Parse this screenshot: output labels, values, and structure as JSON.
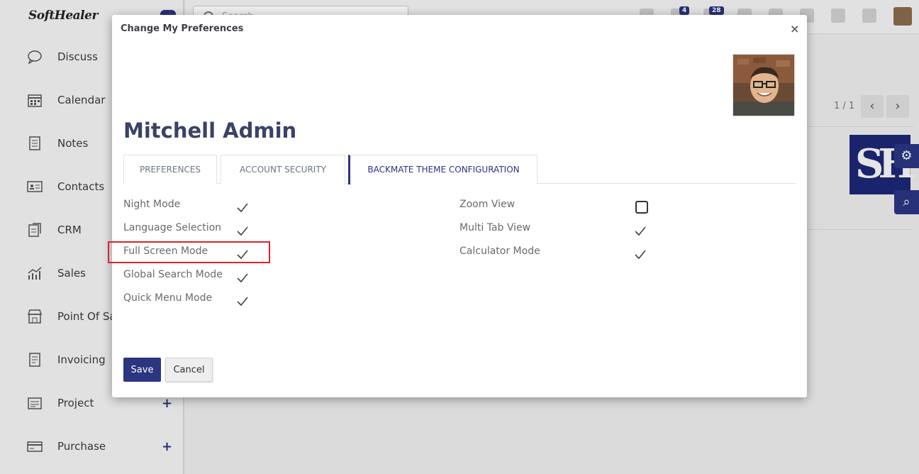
{
  "app": {
    "brand": "SoftHealer",
    "search_placeholder": "Search...",
    "badges": [
      "4",
      "28"
    ]
  },
  "sidebar": {
    "items": [
      {
        "label": "Discuss",
        "icon": "chat-icon",
        "plus": false
      },
      {
        "label": "Calendar",
        "icon": "calendar-icon",
        "plus": false
      },
      {
        "label": "Notes",
        "icon": "notes-icon",
        "plus": false
      },
      {
        "label": "Contacts",
        "icon": "contacts-icon",
        "plus": false
      },
      {
        "label": "CRM",
        "icon": "crm-icon",
        "plus": false
      },
      {
        "label": "Sales",
        "icon": "sales-chart-icon",
        "plus": false
      },
      {
        "label": "Point Of Sale",
        "icon": "store-icon",
        "plus": false
      },
      {
        "label": "Invoicing",
        "icon": "invoice-icon",
        "plus": false
      },
      {
        "label": "Project",
        "icon": "project-icon",
        "plus": true
      },
      {
        "label": "Purchase",
        "icon": "purchase-icon",
        "plus": true
      }
    ],
    "plus_symbol": "+"
  },
  "background": {
    "pager": "1 / 1",
    "prev_symbol": "‹",
    "next_symbol": "›",
    "gear_symbol": "⚙",
    "zoom_symbol": "⌕"
  },
  "modal": {
    "title": "Change My Preferences",
    "close_symbol": "×",
    "user_name": "Mitchell Admin",
    "tabs": [
      {
        "label": "PREFERENCES",
        "active": false
      },
      {
        "label": "ACCOUNT SECURITY",
        "active": false
      },
      {
        "label": "BACKMATE THEME CONFIGURATION",
        "active": true
      }
    ],
    "left_options": [
      {
        "label": "Night Mode",
        "checked": true
      },
      {
        "label": "Language Selection",
        "checked": true
      },
      {
        "label": "Full Screen Mode",
        "checked": true
      },
      {
        "label": "Global Search Mode",
        "checked": true
      },
      {
        "label": "Quick Menu Mode",
        "checked": true
      }
    ],
    "right_options": [
      {
        "label": "Zoom View",
        "checked": false
      },
      {
        "label": "Multi Tab View",
        "checked": true
      },
      {
        "label": "Calculator Mode",
        "checked": true
      }
    ],
    "save_label": "Save",
    "cancel_label": "Cancel"
  },
  "colors": {
    "accent": "#2b3580",
    "highlight": "#d9242b"
  }
}
